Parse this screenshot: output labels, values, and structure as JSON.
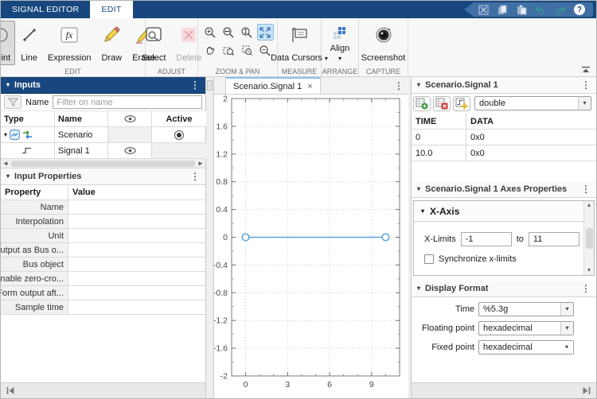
{
  "colors": {
    "titlebar": "#17477E",
    "accent": "#2D7BBF",
    "signal_line": "#58A5DC"
  },
  "window": {
    "tabs": [
      {
        "label": "SIGNAL EDITOR"
      },
      {
        "label": "EDIT"
      }
    ]
  },
  "toolstrip": {
    "sections": [
      {
        "label": "EDIT"
      },
      {
        "label": "ADJUST"
      },
      {
        "label": "ZOOM & PAN"
      },
      {
        "label": "MEASURE"
      },
      {
        "label": "ARRANGE"
      },
      {
        "label": "CAPTURE"
      }
    ],
    "buttons": {
      "point": "Point",
      "line": "Line",
      "expression": "Expression",
      "draw": "Draw",
      "erase": "Erase",
      "select": "Select",
      "delete": "Delete",
      "data_cursors": "Data Cursors",
      "align": "Align",
      "screenshot": "Screenshot"
    }
  },
  "left": {
    "inputs": {
      "title": "Inputs",
      "filter_label": "Name",
      "filter_placeholder": "Filter on name",
      "columns": {
        "type": "Type",
        "name": "Name",
        "active": "Active"
      },
      "rows": [
        {
          "name": "Scenario",
          "active": true
        },
        {
          "name": "Signal 1",
          "visible": true
        }
      ]
    },
    "input_properties": {
      "title": "Input Properties",
      "columns": {
        "property": "Property",
        "value": "Value"
      },
      "rows": [
        "Name",
        "Interpolation",
        "Unit",
        "Output as Bus o...",
        "Bus object",
        "Enable zero-cro...",
        "Form output aft...",
        "Sample time"
      ]
    }
  },
  "document": {
    "tab": "Scenario.Signal 1",
    "close": "×"
  },
  "chart_data": {
    "type": "line",
    "title": "",
    "xlabel": "",
    "ylabel": "",
    "xlim": [
      -1,
      11
    ],
    "ylim": [
      -2,
      2
    ],
    "xticks": [
      0,
      3,
      6,
      9
    ],
    "yticks": [
      -2,
      -1.6,
      -1.2,
      -0.8,
      -0.4,
      0,
      0.4,
      0.8,
      1.2,
      1.6,
      2
    ],
    "grid": true,
    "series": [
      {
        "name": "Scenario.Signal 1",
        "x": [
          0,
          10
        ],
        "y": [
          0,
          0
        ],
        "color": "#58A5DC",
        "marker": "circle"
      }
    ]
  },
  "right": {
    "signal": {
      "title": "Scenario.Signal 1",
      "dtype": "double",
      "columns": {
        "time": "TIME",
        "data": "DATA"
      },
      "rows": [
        [
          "0",
          "0x0"
        ],
        [
          "10.0",
          "0x0"
        ]
      ]
    },
    "axes": {
      "title": "Scenario.Signal 1 Axes Properties",
      "section": "X-Axis",
      "xlimits_label": "X-Limits",
      "xmin": "-1",
      "to_label": "to",
      "xmax": "11",
      "sync_label": "Synchronize x-limits",
      "sync_checked": false
    },
    "display": {
      "title": "Display Format",
      "rows": [
        {
          "label": "Time",
          "value": "%5.3g"
        },
        {
          "label": "Floating point",
          "value": "hexadecimal"
        },
        {
          "label": "Fixed point",
          "value": "hexadecimal"
        }
      ]
    }
  }
}
